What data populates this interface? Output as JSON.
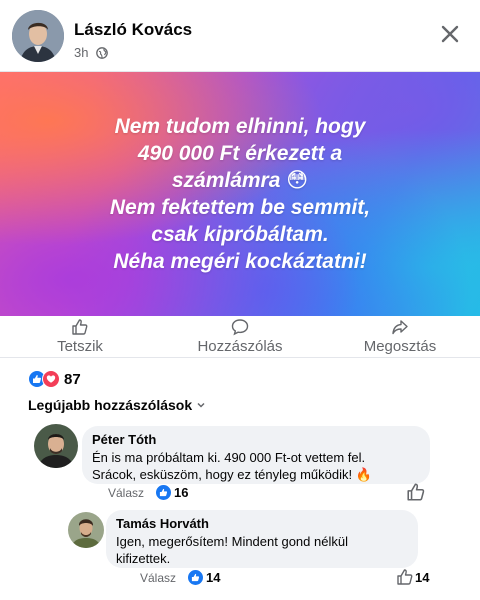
{
  "post": {
    "author": "László Kovács",
    "time": "3h",
    "banner_lines": [
      "Nem tudom elhinni, hogy",
      "490 000 Ft érkezett a",
      "számlámra 😳",
      "Nem fektettem be semmit,",
      "csak kipróbáltam.",
      "Néha megéri kockáztatni!"
    ]
  },
  "actions": {
    "like": "Tetszik",
    "comment": "Hozzászólás",
    "share": "Megosztás"
  },
  "reactions": {
    "count": "87"
  },
  "comments_sort": "Legújabb hozzászólások",
  "comments": [
    {
      "name": "Péter Tóth",
      "text_line1": "Én is ma próbáltam ki. 490 000 Ft-ot vettem fel.",
      "text_line2": "Srácok, esküszöm, hogy ez tényleg működik! 🔥",
      "reply_label": "Válasz",
      "likes": "16"
    },
    {
      "name": "Tamás Horváth",
      "text_line1": "Igen, megerősítem! Mindent gond nélkül",
      "text_line2": "kifizettek.",
      "reply_label": "Válasz",
      "likes": "14",
      "likes_right": "14"
    }
  ],
  "colors": {
    "accent": "#1877f2",
    "love": "#f33e58",
    "bubble": "#f0f2f5",
    "muted": "#65676b"
  }
}
